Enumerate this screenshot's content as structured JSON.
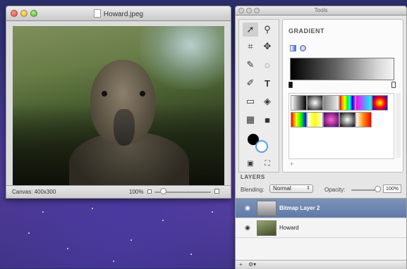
{
  "image_window": {
    "title": "Howard.jpeg",
    "status": {
      "canvas_size": "Canvas: 400x300",
      "zoom": "100%"
    }
  },
  "tools_window": {
    "title": "Tools",
    "tool_icons": [
      "arrow-select-icon",
      "zoom-icon",
      "crop-icon",
      "move-icon",
      "brush-icon",
      "lasso-icon",
      "eyedropper-icon",
      "text-icon",
      "eraser-icon",
      "paint-bucket-icon",
      "gradient-tool-icon",
      "shape-icon",
      "swap-colors-icon",
      "color-wells-icon"
    ],
    "gradient": {
      "heading": "GRADIENT",
      "add_button": "+",
      "swatches": [
        "#ffffff-#000000",
        "#888888-#ffffff",
        "rainbow",
        "radial-rainbow",
        "rainbow-vertical",
        "#ff0-#fff",
        "purple",
        "radial-white",
        "sunset"
      ]
    },
    "layers": {
      "heading": "LAYERS",
      "blending_label": "Blending:",
      "blending_value": "Normal",
      "opacity_label": "Opacity:",
      "opacity_value": "100%",
      "items": [
        {
          "name": "Bitmap Layer 2",
          "selected": true
        },
        {
          "name": "Howard",
          "selected": false
        }
      ],
      "toolbar": {
        "add": "+",
        "gear": "⚙▾"
      }
    }
  },
  "colors": {
    "selection": "#6a82b0",
    "desktop": "#3b3684"
  }
}
